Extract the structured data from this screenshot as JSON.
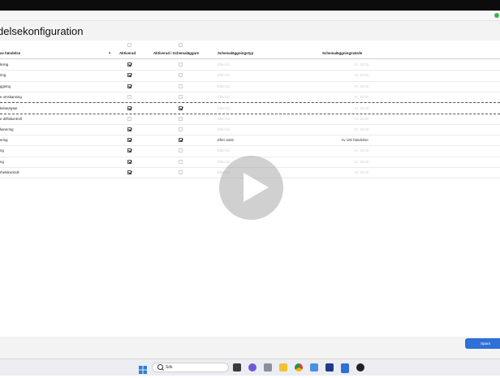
{
  "window": {
    "title": "delsekonfiguration"
  },
  "table": {
    "headers": {
      "name": "av händelse",
      "enabled": "Aktiverad",
      "scheduler": "Aktiverad i Schemaläggare",
      "schedule_type": "Schemaläggningstyp",
      "schedule_value": "Schemaläggningsvärde"
    },
    "rows": [
      {
        "name": "kning",
        "enabled": true,
        "scheduler": false,
        "type": "Efter tid",
        "value": "Kl. 15:00",
        "active": false
      },
      {
        "name": "ring",
        "enabled": true,
        "scheduler": false,
        "type": "Efter tid",
        "value": "Kl. 15:00",
        "active": false
      },
      {
        "name": "ggning",
        "enabled": true,
        "scheduler": false,
        "type": "Efter tid",
        "value": "Kl. 15:00",
        "active": false
      },
      {
        "name": "e omskanning",
        "enabled": false,
        "scheduler": false,
        "type": "Efter tid",
        "value": "Kl. 15:00",
        "active": false
      },
      {
        "name": "kelanalyser",
        "enabled": true,
        "scheduler": true,
        "type": "Efter tid",
        "value": "Kl. 15:00",
        "active": false
      },
      {
        "name": "e driftskontroll",
        "enabled": false,
        "scheduler": false,
        "type": "Efter tid",
        "value": "Kl. 15:00",
        "active": false
      },
      {
        "name": "kanering",
        "enabled": true,
        "scheduler": false,
        "type": "Efter tid",
        "value": "Kl. 15:00",
        "active": false
      },
      {
        "name": "ering",
        "enabled": true,
        "scheduler": true,
        "type": "Efter antal",
        "value": "Av 100 händelser",
        "active": true
      },
      {
        "name": "ng",
        "enabled": true,
        "scheduler": false,
        "type": "Efter tid",
        "value": "Kl. 15:00",
        "active": false
      },
      {
        "name": "ng",
        "enabled": true,
        "scheduler": false,
        "type": "Efter tid",
        "value": "Kl. 15:00",
        "active": false
      },
      {
        "name": "rhetskontroll",
        "enabled": true,
        "scheduler": false,
        "type": "Efter tid",
        "value": "Kl. 15:00",
        "active": false
      }
    ]
  },
  "actions": {
    "save_label": "Spara"
  },
  "taskbar": {
    "search_label": "Sök"
  },
  "colors": {
    "accent": "#2f6fd6",
    "status": "#3bb54a"
  }
}
